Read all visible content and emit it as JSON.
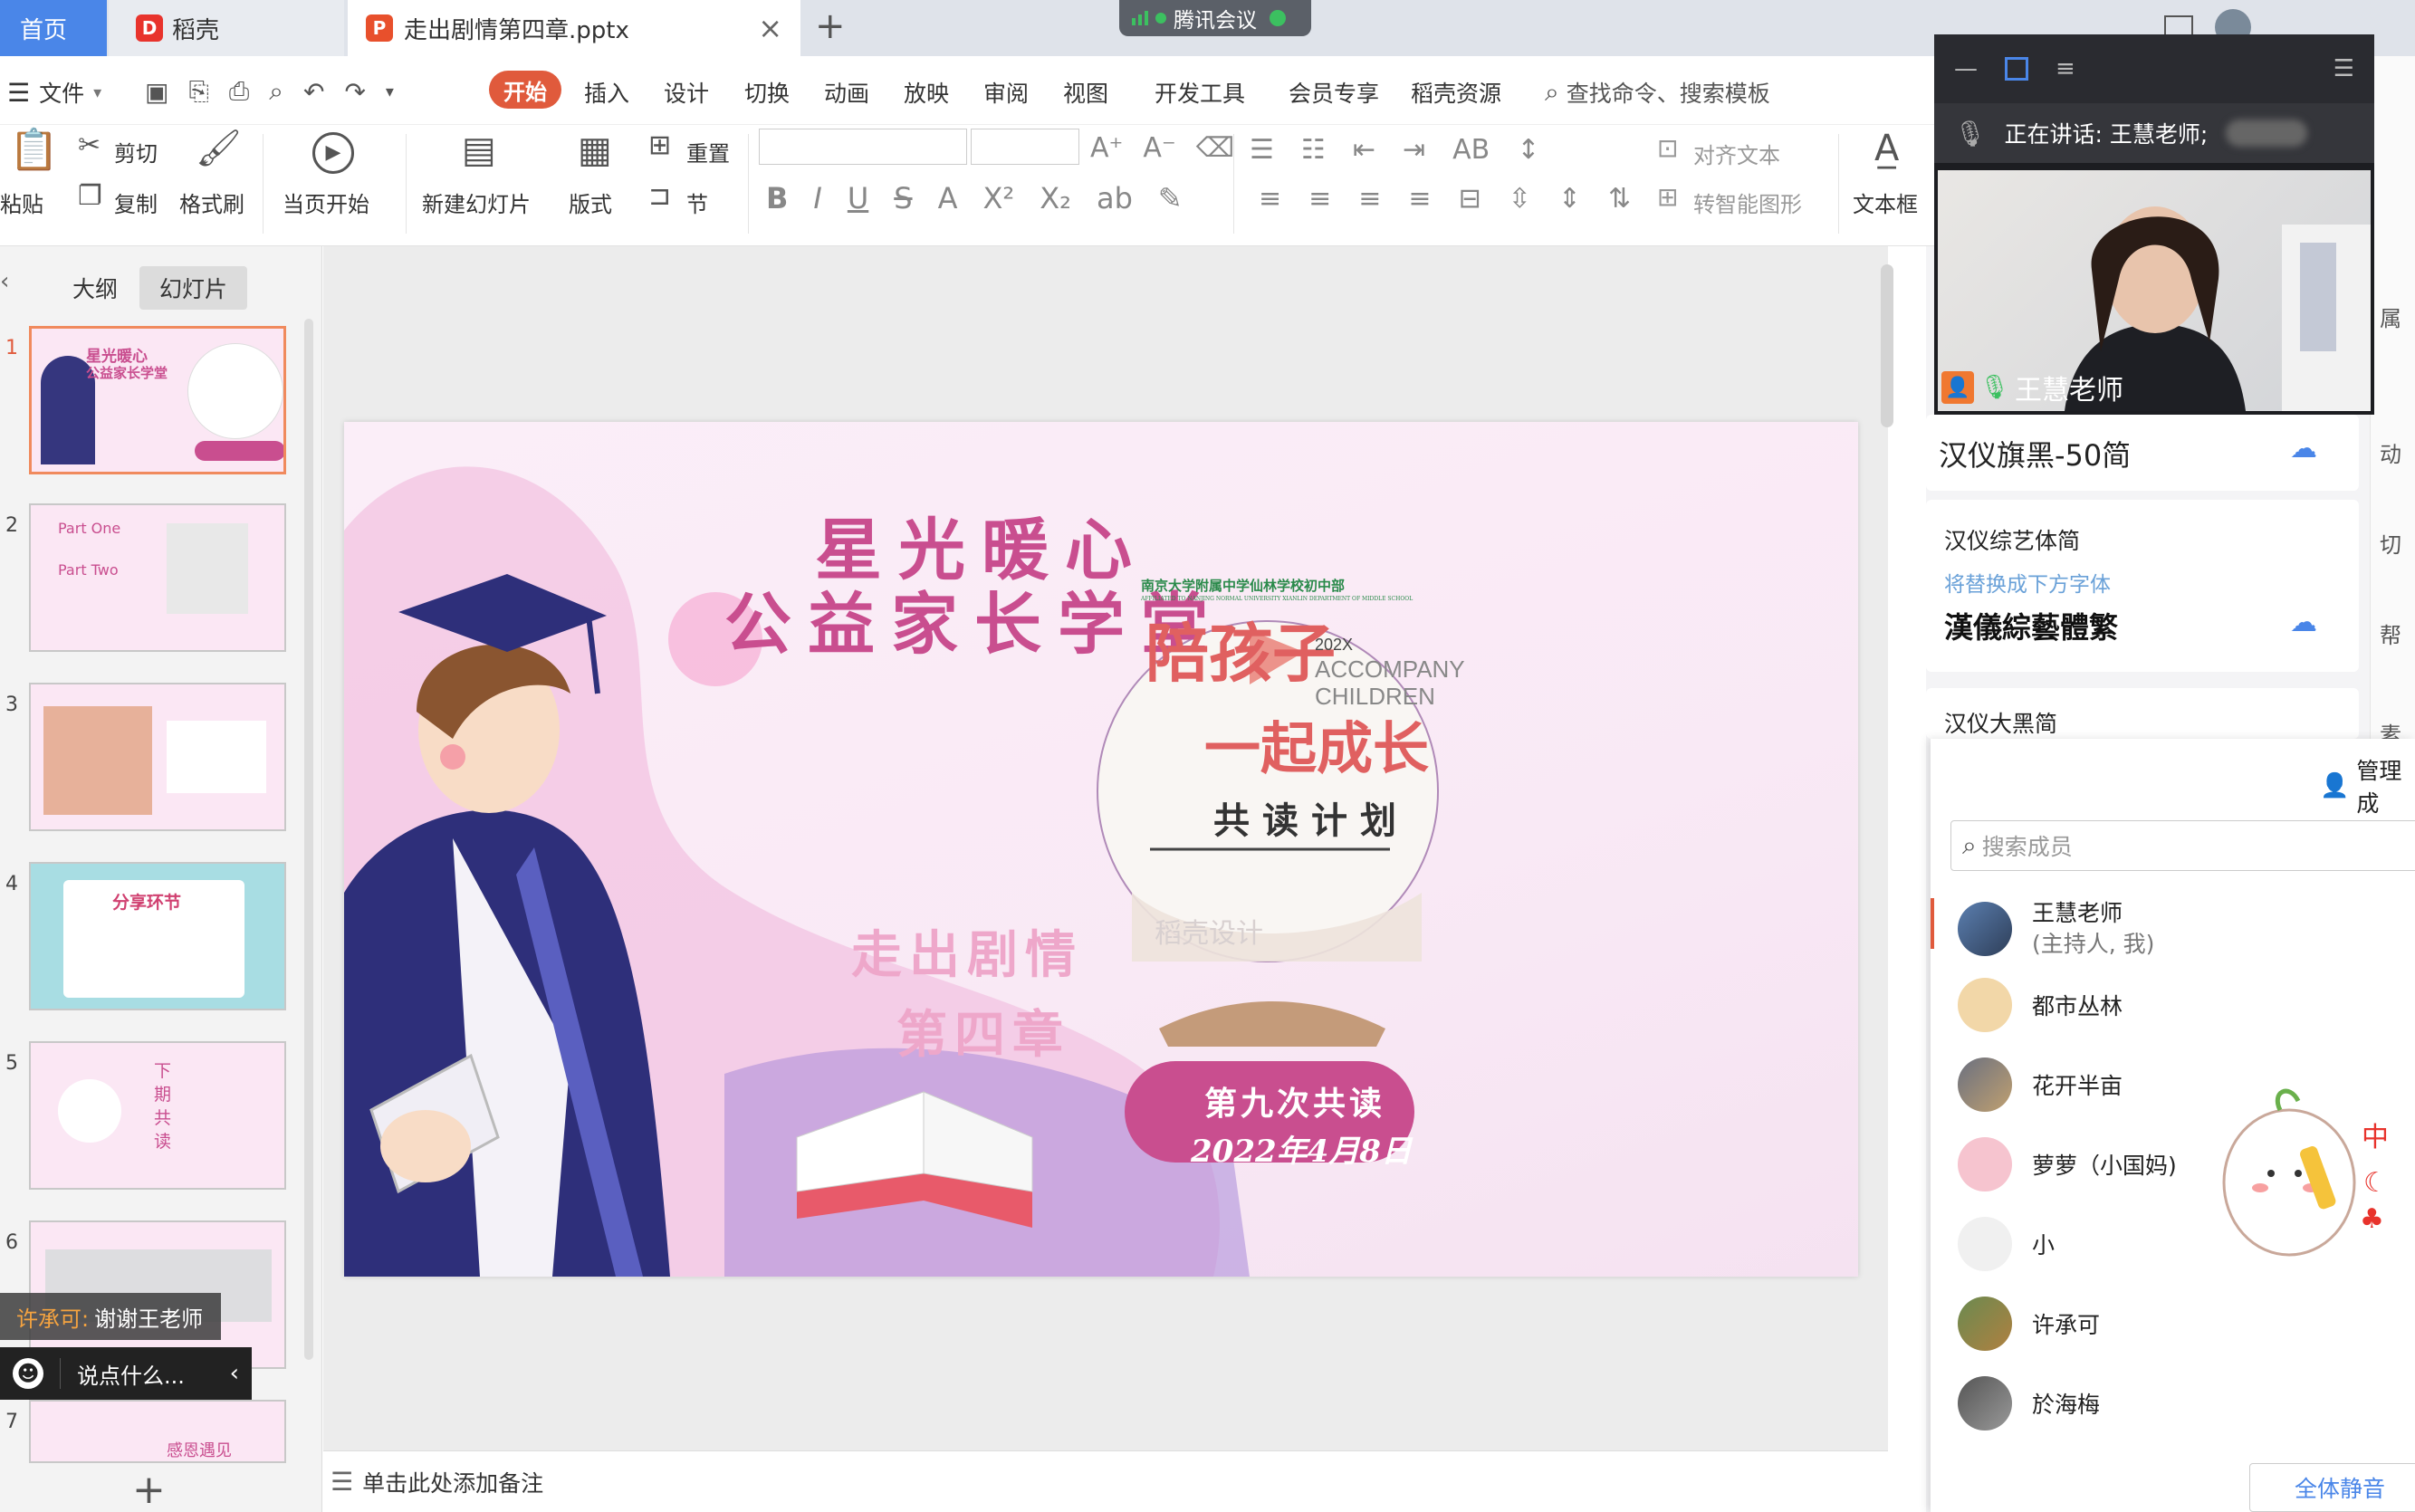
{
  "tabs": {
    "home": "首页",
    "daoke": "稻壳",
    "doc": "走出剧情第四章.pptx",
    "doc_logo": "P",
    "daoke_logo": "D",
    "new_tab": "+",
    "close": "×"
  },
  "meeting": {
    "app": "腾讯会议"
  },
  "menu": {
    "file": "文件",
    "items": [
      "开始",
      "插入",
      "设计",
      "切换",
      "动画",
      "放映",
      "审阅",
      "视图",
      "开发工具",
      "会员专享",
      "稻壳资源"
    ],
    "search": "查找命令、搜索模板"
  },
  "ribbon": {
    "paste": "粘贴",
    "cut": "剪切",
    "copy": "复制",
    "format_painter": "格式刷",
    "play_current": "当页开始",
    "new_slide": "新建幻灯片",
    "layout": "版式",
    "reset": "重置",
    "section": "节",
    "align_text": "对齐文本",
    "smart_shape": "转智能图形",
    "textbox": "文本框"
  },
  "leftpane": {
    "tab_outline": "大纲",
    "tab_slides": "幻灯片",
    "thumb_numbers": [
      "1",
      "2",
      "3",
      "4",
      "5",
      "6",
      "7"
    ],
    "add": "+",
    "thumb2_part1": "Part One",
    "thumb2_part2": "Part Two",
    "thumb4_title": "分享环节",
    "thumb5_title": "下期共读",
    "thumb7_text": "感恩遇见"
  },
  "slide": {
    "title1": "星光暖心",
    "title2": "公益家长学堂",
    "subtitle1": "走出剧情",
    "subtitle2": "第四章",
    "circle_school": "南京大学附属中学仙林学校初中部",
    "circle_school_en": "AFFILIATED TO NANJING NORMAL UNIVERSITY XIANLIN DEPARTMENT OF MIDDLE SCHOOL",
    "circle_big1": "陪孩子",
    "circle_big2": "一起成长",
    "circle_year": "202X",
    "circle_en1": "ACCOMPANY",
    "circle_en2": "CHILDREN",
    "circle_plan": "共读计划",
    "circle_watermark": "稻壳设计",
    "badge1": "第九次共读",
    "badge2": "2022年4月8日"
  },
  "video": {
    "speaking": "正在讲话: 王慧老师;",
    "name": "王慧老师"
  },
  "fonts": {
    "f1": "汉仪旗黑-50简",
    "f2": "汉仪综艺体简",
    "f2_hint": "将替换成下方字体",
    "f2_preview": "漢儀綜藝體繁",
    "f3": "汉仪大黑简"
  },
  "members": {
    "title": "管理成",
    "search_placeholder": "搜索成员",
    "list": [
      {
        "name": "王慧老师",
        "sub": "(主持人, 我)"
      },
      {
        "name": "都市丛林",
        "sub": ""
      },
      {
        "name": "花开半亩",
        "sub": ""
      },
      {
        "name": "萝萝（小国妈)",
        "sub": ""
      },
      {
        "name": "小",
        "sub": ""
      },
      {
        "name": "许承可",
        "sub": ""
      },
      {
        "name": "於海梅",
        "sub": ""
      }
    ],
    "mute_all": "全体静音"
  },
  "chat": {
    "sender": "许承可:",
    "message": "谢谢王老师",
    "input": "说点什么..."
  },
  "notes": {
    "placeholder": "单击此处添加备注"
  },
  "sidebar_right": [
    "属",
    "动",
    "切",
    "帮",
    "素"
  ],
  "colors": {
    "accent_blue": "#4a86e8",
    "start_red": "#e05a3c",
    "slide_pink": "#c94e8f",
    "navy": "#2e2f7a"
  }
}
